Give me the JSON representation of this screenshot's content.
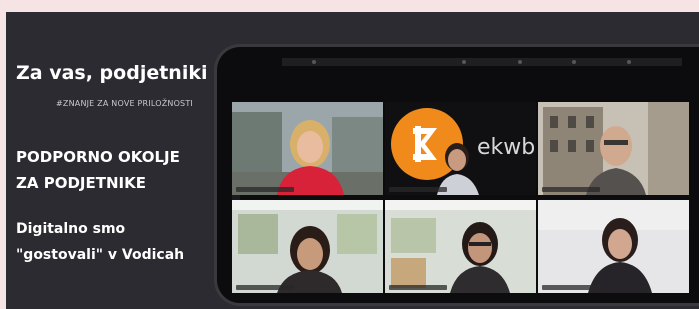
{
  "heading": {
    "title": "Za vas, podjetniki",
    "hashtag": "#ZNANJE ZA NOVE PRILOŽNOSTI",
    "subtitle_line1": "PODPORNO OKOLJE",
    "subtitle_line2": "ZA PODJETNIKE",
    "body_line1": "Digitalno smo",
    "body_line2": "\"gostovali\" v Vodicah"
  },
  "video_call": {
    "logo_text": "ekwb",
    "tiles": [
      {
        "id": "participant-1"
      },
      {
        "id": "participant-2-logo-ek"
      },
      {
        "id": "participant-3"
      },
      {
        "id": "participant-4"
      },
      {
        "id": "participant-5"
      },
      {
        "id": "participant-6"
      }
    ]
  },
  "colors": {
    "background": "#f6e4e4",
    "card": "#2c2b31",
    "logo_orange": "#f08a1b"
  }
}
